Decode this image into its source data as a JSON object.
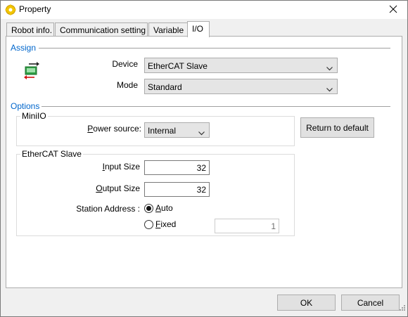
{
  "window": {
    "title": "Property",
    "title_icon": "gear-icon",
    "close_icon": "close-icon"
  },
  "tabs": [
    {
      "label": "Robot info.",
      "active": false
    },
    {
      "label": "Communication setting",
      "active": false
    },
    {
      "label": "Variable",
      "active": false
    },
    {
      "label": "I/O",
      "active": true
    }
  ],
  "assign": {
    "section_label": "Assign",
    "icon": "io-transfer-icon",
    "device_label": "Device",
    "device_value": "EtherCAT Slave",
    "mode_label": "Mode",
    "mode_value": "Standard"
  },
  "options": {
    "section_label": "Options",
    "miniio": {
      "group_label": "MiniIO",
      "power_source_label_access": "P",
      "power_source_label_rest": "ower source:",
      "power_source_value": "Internal"
    },
    "return_default_label": "Return to default",
    "ethercat": {
      "group_label": "EtherCAT Slave",
      "input_size_label_access": "I",
      "input_size_label_rest": "nput Size",
      "input_size_value": "32",
      "output_size_label_access": "O",
      "output_size_label_rest": "utput Size",
      "output_size_value": "32",
      "station_address_label": "Station Address :",
      "auto_label_access": "A",
      "auto_label_rest": "uto",
      "fixed_label_access": "F",
      "fixed_label_rest": "ixed",
      "station_address_mode": "Auto",
      "fixed_value": "1"
    }
  },
  "footer": {
    "ok_label": "OK",
    "cancel_label": "Cancel"
  },
  "colors": {
    "section_accent": "#0066cc",
    "panel_background": "#ffffff",
    "window_background": "#f0f0f0"
  }
}
